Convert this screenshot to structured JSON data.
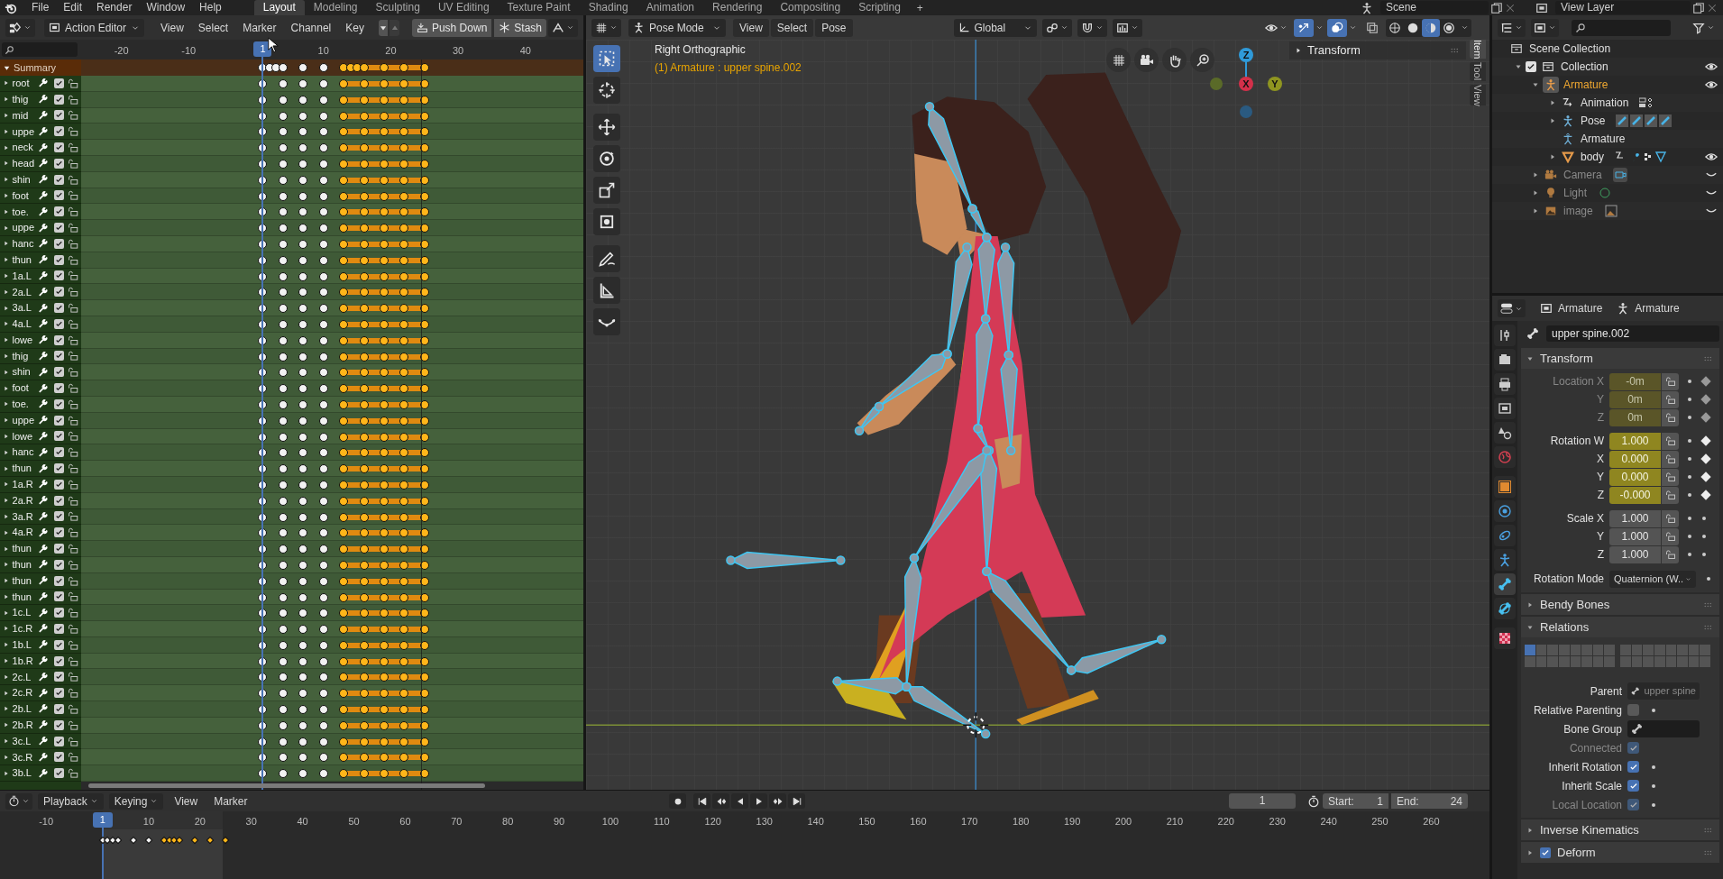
{
  "top_bar": {
    "menus": [
      "File",
      "Edit",
      "Render",
      "Window",
      "Help"
    ],
    "workspaces": [
      {
        "label": "Layout",
        "selected": true
      },
      {
        "label": "Modeling",
        "selected": false
      },
      {
        "label": "Sculpting",
        "selected": false
      },
      {
        "label": "UV Editing",
        "selected": false
      },
      {
        "label": "Texture Paint",
        "selected": false
      },
      {
        "label": "Shading",
        "selected": false
      },
      {
        "label": "Animation",
        "selected": false
      },
      {
        "label": "Rendering",
        "selected": false
      },
      {
        "label": "Compositing",
        "selected": false
      },
      {
        "label": "Scripting",
        "selected": false
      }
    ],
    "add_workspace": "+",
    "scene": "Scene",
    "view_layer": "View Layer"
  },
  "dope_sheet": {
    "mode": "Action Editor",
    "menus": [
      "View",
      "Select",
      "Marker",
      "Channel",
      "Key"
    ],
    "push_down": "Push Down",
    "stash": "Stash",
    "ruler": [
      "-20",
      "-10",
      "10",
      "20",
      "30",
      "40"
    ],
    "current_frame": "1",
    "summary": {
      "label": "Summary",
      "expanded": true
    },
    "summary_keys": [
      {
        "selected": false
      },
      {
        "selected": false
      },
      {
        "selected": false
      },
      {
        "selected": false
      },
      {
        "selected": false
      },
      {
        "selected": false
      },
      {
        "selected": true
      },
      {
        "selected": true
      },
      {
        "selected": true
      },
      {
        "selected": true
      },
      {
        "selected": true
      },
      {
        "selected": true
      },
      {
        "selected": true
      }
    ],
    "row_keys": [
      {
        "selected": false
      },
      {
        "selected": false
      },
      {
        "selected": false
      },
      {
        "selected": false
      },
      {
        "selected": true
      },
      {
        "selected": true
      },
      {
        "selected": true
      },
      {
        "selected": true
      },
      {
        "selected": true
      }
    ],
    "channels": [
      {
        "name": "root",
        "expanded": false,
        "checked": true,
        "locked": false
      },
      {
        "name": "thig",
        "expanded": false,
        "checked": true,
        "locked": false
      },
      {
        "name": "mid",
        "expanded": false,
        "checked": true,
        "locked": false
      },
      {
        "name": "uppe",
        "expanded": false,
        "checked": true,
        "locked": false
      },
      {
        "name": "neck",
        "expanded": false,
        "checked": true,
        "locked": false
      },
      {
        "name": "head",
        "expanded": false,
        "checked": true,
        "locked": false
      },
      {
        "name": "shin",
        "expanded": false,
        "checked": true,
        "locked": false
      },
      {
        "name": "foot",
        "expanded": false,
        "checked": true,
        "locked": false
      },
      {
        "name": "toe.",
        "expanded": false,
        "checked": true,
        "locked": false
      },
      {
        "name": "uppe",
        "expanded": false,
        "checked": true,
        "locked": false
      },
      {
        "name": "hanc",
        "expanded": false,
        "checked": true,
        "locked": false
      },
      {
        "name": "thun",
        "expanded": false,
        "checked": true,
        "locked": false
      },
      {
        "name": "1a.L",
        "expanded": false,
        "checked": true,
        "locked": false
      },
      {
        "name": "2a.L",
        "expanded": false,
        "checked": true,
        "locked": false
      },
      {
        "name": "3a.L",
        "expanded": false,
        "checked": true,
        "locked": false
      },
      {
        "name": "4a.L",
        "expanded": false,
        "checked": true,
        "locked": false
      },
      {
        "name": "lowe",
        "expanded": false,
        "checked": true,
        "locked": false
      },
      {
        "name": "thig",
        "expanded": false,
        "checked": true,
        "locked": false
      },
      {
        "name": "shin",
        "expanded": false,
        "checked": true,
        "locked": false
      },
      {
        "name": "foot",
        "expanded": false,
        "checked": true,
        "locked": false
      },
      {
        "name": "toe.",
        "expanded": false,
        "checked": true,
        "locked": false
      },
      {
        "name": "uppe",
        "expanded": false,
        "checked": true,
        "locked": false
      },
      {
        "name": "lowe",
        "expanded": false,
        "checked": true,
        "locked": false
      },
      {
        "name": "hanc",
        "expanded": false,
        "checked": true,
        "locked": false
      },
      {
        "name": "thun",
        "expanded": false,
        "checked": true,
        "locked": false
      },
      {
        "name": "1a.R",
        "expanded": false,
        "checked": true,
        "locked": false
      },
      {
        "name": "2a.R",
        "expanded": false,
        "checked": true,
        "locked": false
      },
      {
        "name": "3a.R",
        "expanded": false,
        "checked": true,
        "locked": false
      },
      {
        "name": "4a.R",
        "expanded": false,
        "checked": true,
        "locked": false
      },
      {
        "name": "thun",
        "expanded": false,
        "checked": true,
        "locked": false
      },
      {
        "name": "thun",
        "expanded": false,
        "checked": true,
        "locked": false
      },
      {
        "name": "thun",
        "expanded": false,
        "checked": true,
        "locked": false
      },
      {
        "name": "thun",
        "expanded": false,
        "checked": true,
        "locked": false
      },
      {
        "name": "1c.L",
        "expanded": false,
        "checked": true,
        "locked": false
      },
      {
        "name": "1c.R",
        "expanded": false,
        "checked": true,
        "locked": false
      },
      {
        "name": "1b.L",
        "expanded": false,
        "checked": true,
        "locked": false
      },
      {
        "name": "1b.R",
        "expanded": false,
        "checked": true,
        "locked": false
      },
      {
        "name": "2c.L",
        "expanded": false,
        "checked": true,
        "locked": false
      },
      {
        "name": "2c.R",
        "expanded": false,
        "checked": true,
        "locked": false
      },
      {
        "name": "2b.L",
        "expanded": false,
        "checked": true,
        "locked": false
      },
      {
        "name": "2b.R",
        "expanded": false,
        "checked": true,
        "locked": false
      },
      {
        "name": "3c.L",
        "expanded": false,
        "checked": true,
        "locked": false
      },
      {
        "name": "3c.R",
        "expanded": false,
        "checked": true,
        "locked": false
      },
      {
        "name": "3b.L",
        "expanded": false,
        "checked": true,
        "locked": false
      }
    ]
  },
  "viewport": {
    "mode": "Pose Mode",
    "menus": [
      "View",
      "Select",
      "Pose"
    ],
    "orientation": "Global",
    "view_name": "Right Orthographic",
    "active_label": "(1) Armature : upper spine.002",
    "tools": [
      {
        "kind": "select_box",
        "selected": true
      },
      {
        "kind": "cursor",
        "selected": false
      },
      {
        "kind": "move",
        "selected": false
      },
      {
        "kind": "rotate",
        "selected": false
      },
      {
        "kind": "scale",
        "selected": false
      },
      {
        "kind": "transform",
        "selected": false
      },
      {
        "kind": "annotate",
        "selected": false
      },
      {
        "kind": "measure",
        "selected": false
      },
      {
        "kind": "relax",
        "selected": false
      }
    ],
    "gizmo": [
      {
        "kind": "z",
        "label": "Z",
        "color": "#2f9ad9"
      },
      {
        "kind": "x",
        "label": "X",
        "color": "#d4304a"
      },
      {
        "kind": "y",
        "label": "Y",
        "color": "#8f9520"
      }
    ],
    "shading": [
      {
        "kind": "wireframe",
        "selected": false
      },
      {
        "kind": "solid",
        "selected": false
      },
      {
        "kind": "material",
        "selected": true
      },
      {
        "kind": "rendered",
        "selected": false
      }
    ],
    "sidebar_panel": {
      "title": "Transform",
      "expanded": false
    },
    "sidebar_tabs": [
      {
        "label": "Item",
        "selected": true
      },
      {
        "label": "Tool",
        "selected": false
      },
      {
        "label": "View",
        "selected": false
      }
    ]
  },
  "outliner": {
    "items": [
      {
        "label": "Scene Collection",
        "kind": "scene_collection",
        "children": [
          {
            "label": "Collection",
            "kind": "collection",
            "expanded": true,
            "checked": true,
            "visible": true,
            "children": [
              {
                "label": "Armature",
                "kind": "armature",
                "active": true,
                "expanded": true,
                "visible": true,
                "children": [
                  {
                    "label": "Animation",
                    "kind": "action",
                    "expanded": false
                  },
                  {
                    "label": "Pose",
                    "kind": "pose",
                    "expanded": false
                  },
                  {
                    "label": "Armature",
                    "kind": "armature_data"
                  },
                  {
                    "label": "body",
                    "kind": "mesh",
                    "expanded": false,
                    "visible": true
                  }
                ]
              },
              {
                "label": "Camera",
                "kind": "camera",
                "expanded": false,
                "visible": false
              },
              {
                "label": "Light",
                "kind": "light",
                "expanded": false,
                "visible": false
              },
              {
                "label": "image",
                "kind": "image",
                "expanded": false,
                "visible": false
              }
            ]
          }
        ]
      }
    ]
  },
  "properties": {
    "tabs": [
      {
        "kind": "tool",
        "selected": false
      },
      {
        "kind": "render",
        "selected": false
      },
      {
        "kind": "output",
        "selected": false
      },
      {
        "kind": "view_layer",
        "selected": false
      },
      {
        "kind": "scene",
        "selected": false
      },
      {
        "kind": "world",
        "selected": false
      },
      {
        "kind": "object",
        "selected": false
      },
      {
        "kind": "physics",
        "selected": false
      },
      {
        "kind": "constraints",
        "selected": false
      },
      {
        "kind": "data",
        "selected": false
      },
      {
        "kind": "bone",
        "selected": true
      },
      {
        "kind": "bone_constraint",
        "selected": false
      },
      {
        "kind": "texture",
        "selected": false
      }
    ],
    "context": [
      {
        "kind": "object",
        "label": "Armature"
      },
      {
        "kind": "armature",
        "label": "Armature"
      }
    ],
    "bone_name": "upper spine.002",
    "panels": [
      {
        "kind": "transform",
        "title": "Transform",
        "expanded": true,
        "rows": [
          {
            "label": "Location X",
            "value": "-0m",
            "keyed": true,
            "disabled": true
          },
          {
            "label": "Y",
            "value": "0m",
            "keyed": true,
            "disabled": true
          },
          {
            "label": "Z",
            "value": "0m",
            "keyed": true,
            "disabled": true
          },
          {
            "label": "Rotation W",
            "value": "1.000",
            "keyed": true,
            "disabled": false
          },
          {
            "label": "X",
            "value": "0.000",
            "keyed": true,
            "disabled": false
          },
          {
            "label": "Y",
            "value": "0.000",
            "keyed": true,
            "disabled": false
          },
          {
            "label": "Z",
            "value": "-0.000",
            "keyed": true,
            "disabled": false
          },
          {
            "label": "Scale X",
            "value": "1.000",
            "keyed": false,
            "disabled": false
          },
          {
            "label": "Y",
            "value": "1.000",
            "keyed": false,
            "disabled": false
          },
          {
            "label": "Z",
            "value": "1.000",
            "keyed": false,
            "disabled": false
          }
        ],
        "rotation_mode_label": "Rotation Mode",
        "rotation_mode": "Quaternion (W.."
      },
      {
        "kind": "collapsed",
        "title": "Bendy Bones",
        "expanded": false
      },
      {
        "kind": "relations",
        "title": "Relations",
        "expanded": true,
        "layers": [
          {
            "selected": true
          },
          {
            "selected": false
          },
          {
            "selected": false
          },
          {
            "selected": false
          },
          {
            "selected": false
          },
          {
            "selected": false
          },
          {
            "selected": false
          },
          {
            "selected": false
          },
          {
            "selected": false
          },
          {
            "selected": false
          },
          {
            "selected": false
          },
          {
            "selected": false
          },
          {
            "selected": false
          },
          {
            "selected": false
          },
          {
            "selected": false
          },
          {
            "selected": false
          },
          {
            "selected": false
          },
          {
            "selected": false
          },
          {
            "selected": false
          },
          {
            "selected": false
          },
          {
            "selected": false
          },
          {
            "selected": false
          },
          {
            "selected": false
          },
          {
            "selected": false
          },
          {
            "selected": false
          },
          {
            "selected": false
          },
          {
            "selected": false
          },
          {
            "selected": false
          },
          {
            "selected": false
          },
          {
            "selected": false
          },
          {
            "selected": false
          },
          {
            "selected": false
          }
        ],
        "rows": [
          {
            "kind": "parent",
            "label": "Parent",
            "value": "upper spine"
          },
          {
            "kind": "checkbox",
            "label": "Relative Parenting",
            "checked": false,
            "disabled": false
          },
          {
            "kind": "group",
            "label": "Bone Group"
          },
          {
            "kind": "checkbox",
            "label": "Connected",
            "checked": true,
            "disabled": true
          },
          {
            "kind": "checkbox",
            "label": "Inherit Rotation",
            "checked": true,
            "disabled": false
          },
          {
            "kind": "checkbox",
            "label": "Inherit Scale",
            "checked": true,
            "disabled": false
          },
          {
            "kind": "checkbox",
            "label": "Local Location",
            "checked": true,
            "disabled": true
          }
        ]
      },
      {
        "kind": "collapsed",
        "title": "Inverse Kinematics",
        "expanded": false
      },
      {
        "kind": "collapsed",
        "title": "Deform",
        "expanded": false,
        "checked": true
      }
    ]
  },
  "timeline": {
    "menus": [
      {
        "label": "Playback",
        "dropdown": true
      },
      {
        "label": "Keying",
        "dropdown": true
      },
      {
        "label": "View",
        "dropdown": false
      },
      {
        "label": "Marker",
        "dropdown": false
      }
    ],
    "transport": [
      {
        "kind": "record"
      },
      {
        "kind": "jump_start"
      },
      {
        "kind": "prev_key"
      },
      {
        "kind": "play_reverse"
      },
      {
        "kind": "play"
      },
      {
        "kind": "next_key"
      },
      {
        "kind": "jump_end"
      }
    ],
    "frame": "1",
    "start_label": "Start:",
    "start": "1",
    "end_label": "End:",
    "end": "24",
    "current_frame": "1",
    "ruler": [
      "-10",
      "10",
      "20",
      "30",
      "40",
      "50",
      "60",
      "70",
      "80",
      "90",
      "100",
      "110",
      "120",
      "130",
      "140",
      "150",
      "160",
      "170",
      "180",
      "190",
      "200",
      "210",
      "220",
      "230",
      "240",
      "250",
      "260"
    ],
    "keys": [
      {
        "selected": false
      },
      {
        "selected": false
      },
      {
        "selected": false
      },
      {
        "selected": false
      },
      {
        "selected": false
      },
      {
        "selected": false
      },
      {
        "selected": true
      },
      {
        "selected": true
      },
      {
        "selected": true
      },
      {
        "selected": true
      },
      {
        "selected": true
      },
      {
        "selected": true
      },
      {
        "selected": true
      }
    ]
  }
}
